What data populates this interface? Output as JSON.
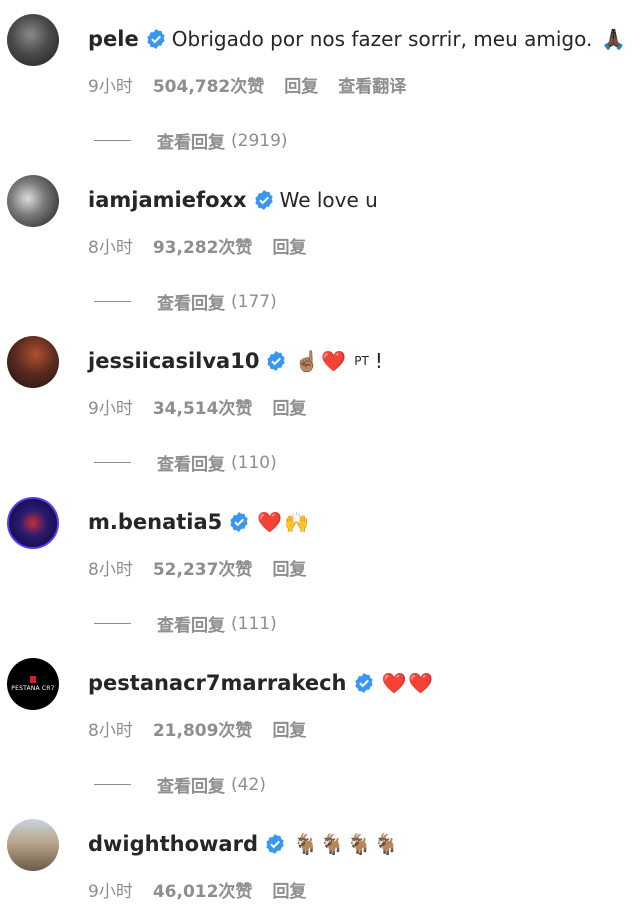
{
  "comments": [
    {
      "username": "pele",
      "text": "Obrigado por nos fazer sorrir, meu amigo.",
      "emojis": [
        "🙏🏿"
      ],
      "time": "9小时",
      "likes": "504,782次赞",
      "reply": "回复",
      "translate": "查看翻译",
      "view_replies": "查看回复",
      "reply_count": "(2919)",
      "avatar_icon": "pele-avatar-icon",
      "avatar_color": "#3a3a3a"
    },
    {
      "username": "iamjamiefoxx",
      "text": "We love u",
      "emojis": [],
      "time": "8小时",
      "likes": "93,282次赞",
      "reply": "回复",
      "view_replies": "查看回复",
      "reply_count": "(177)",
      "avatar_icon": "jamiefoxx-avatar-icon",
      "avatar_color": "#2a2a2a"
    },
    {
      "username": "jessiicasilva10",
      "text": "",
      "emojis": [
        "☝🏽",
        "❤️"
      ],
      "suffix": "PT",
      "suffix2": "!",
      "time": "9小时",
      "likes": "34,514次赞",
      "reply": "回复",
      "view_replies": "查看回复",
      "reply_count": "(110)",
      "avatar_icon": "jessiica-avatar-icon",
      "avatar_color": "#5a2a20"
    },
    {
      "username": "m.benatia5",
      "text": "",
      "emojis": [
        "❤️",
        "🙌"
      ],
      "time": "8小时",
      "likes": "52,237次赞",
      "reply": "回复",
      "view_replies": "查看回复",
      "reply_count": "(111)",
      "avatar_icon": "benatia-avatar-icon",
      "avatar_color": "#1a1450"
    },
    {
      "username": "pestanacr7marrakech",
      "text": "",
      "emojis": [
        "❤️",
        "❤️"
      ],
      "time": "8小时",
      "likes": "21,809次赞",
      "reply": "回复",
      "view_replies": "查看回复",
      "reply_count": "(42)",
      "avatar_icon": "pestana-avatar-icon",
      "avatar_color": "#000000",
      "avatar_text": "PESTANA CR7"
    },
    {
      "username": "dwighthoward",
      "text": "",
      "emojis": [
        "🐐",
        "🐐",
        "🐐",
        "🐐"
      ],
      "time": "9小时",
      "likes": "46,012次赞",
      "reply": "回复",
      "avatar_icon": "dwighthoward-avatar-icon",
      "avatar_color": "#8a7a66"
    }
  ],
  "verified_color": "#3897f0"
}
